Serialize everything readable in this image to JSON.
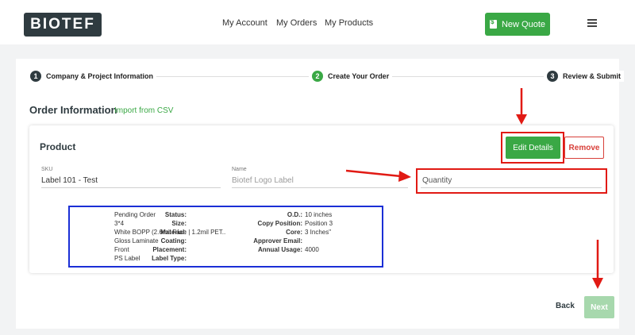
{
  "header": {
    "logo": "BIOTEF",
    "nav": [
      "My Account",
      "My Orders",
      "My Products"
    ],
    "new_quote": "New Quote"
  },
  "steps": [
    {
      "num": "1",
      "label": "Company & Project Information"
    },
    {
      "num": "2",
      "label": "Create Your Order"
    },
    {
      "num": "3",
      "label": "Review & Submit"
    }
  ],
  "order": {
    "title": "Order Information",
    "import_link": "Import from CSV"
  },
  "product": {
    "title": "Product",
    "edit_label": "Edit Details",
    "remove_label": "Remove",
    "sku_label": "SKU",
    "sku_value": "Label 101 - Test",
    "name_label": "Name",
    "name_placeholder": "Biotef Logo Label",
    "quantity_placeholder": "Quantity",
    "details_left": [
      {
        "k": "Status:",
        "v": "Pending Order"
      },
      {
        "k": "Size:",
        "v": "3*4"
      },
      {
        "k": "Material:",
        "v": "White BOPP (2.6mil Face | 1.2mil PET..."
      },
      {
        "k": "Coating:",
        "v": "Gloss Laminate"
      },
      {
        "k": "Placement:",
        "v": "Front"
      },
      {
        "k": "Label Type:",
        "v": "PS Label"
      }
    ],
    "details_right": [
      {
        "k": "O.D.:",
        "v": "10 inches"
      },
      {
        "k": "Copy Position:",
        "v": "Position 3"
      },
      {
        "k": "Core:",
        "v": "3 Inches\""
      },
      {
        "k": "Approver Email:",
        "v": ""
      },
      {
        "k": "Annual Usage:",
        "v": "4000"
      }
    ]
  },
  "footer": {
    "back": "Back",
    "next": "Next"
  },
  "colors": {
    "brand_dark": "#2f3b40",
    "accent_green": "#3aa845",
    "annotation_red": "#e11a14",
    "annotation_blue": "#1b2fd6"
  }
}
